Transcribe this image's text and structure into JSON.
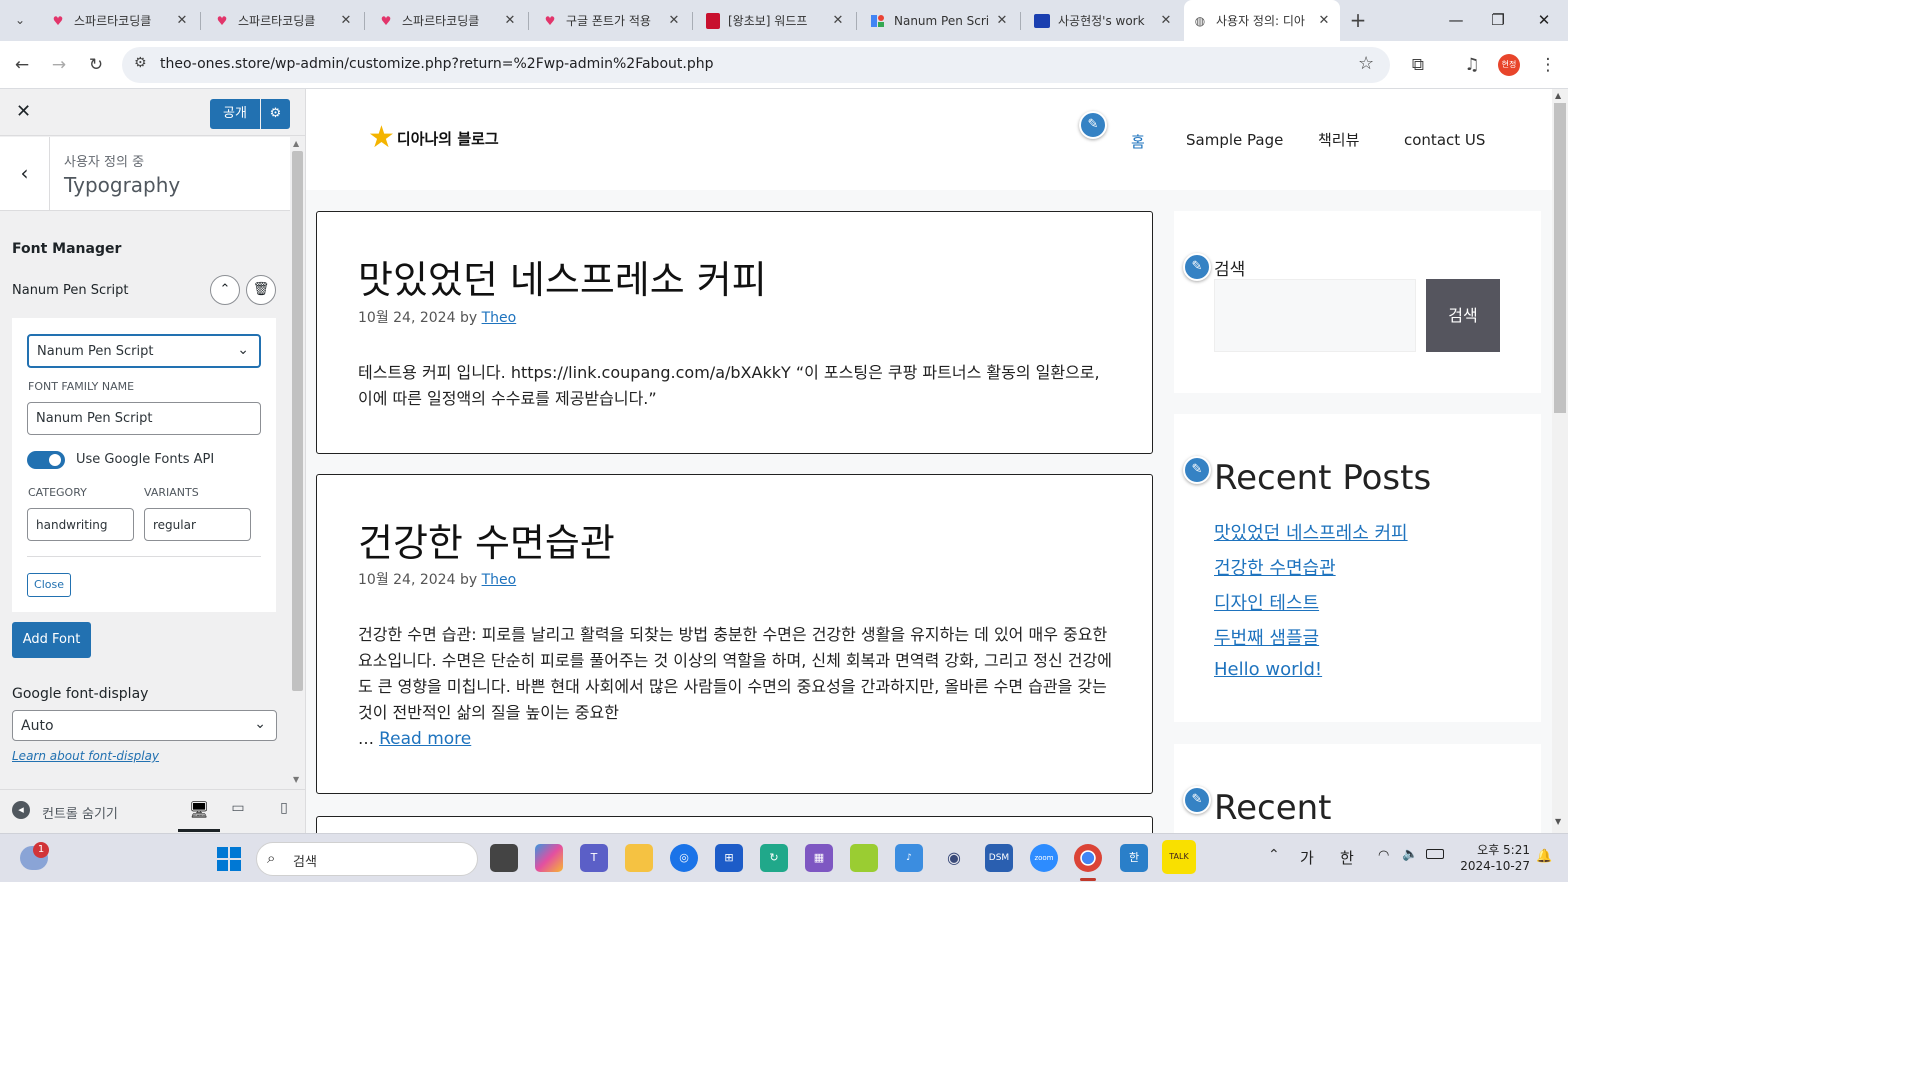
{
  "browser": {
    "tabs": [
      {
        "title": "스파르타코딩클",
        "favicon": "heart-icon"
      },
      {
        "title": "스파르타코딩클",
        "favicon": "heart-icon"
      },
      {
        "title": "스파르타코딩클",
        "favicon": "heart-icon"
      },
      {
        "title": "구글 폰트가 적용",
        "favicon": "heart-icon"
      },
      {
        "title": "[왕초보] 워드프",
        "favicon": "book-icon"
      },
      {
        "title": "Nanum Pen Scri",
        "favicon": "google-fonts-icon"
      },
      {
        "title": "사공현정's work",
        "favicon": "card-icon"
      },
      {
        "title": "사용자 정의: 디아",
        "favicon": "globe-icon"
      }
    ],
    "url": "theo-ones.store/wp-admin/customize.php?return=%2Fwp-admin%2Fabout.php",
    "profile_badge": "현정"
  },
  "customizer": {
    "publish_label": "공개",
    "breadcrumb_small": "사용자 정의 중",
    "section_title": "Typography",
    "font_manager_title": "Font Manager",
    "font_item_name": "Nanum Pen Script",
    "selected_font": "Nanum Pen Script",
    "family_name_label": "FONT FAMILY NAME",
    "family_name_value": "Nanum Pen Script",
    "google_api_label": "Use Google Fonts API",
    "category_label": "CATEGORY",
    "category_value": "handwriting",
    "variants_label": "VARIANTS",
    "variants_value": "regular",
    "close_label": "Close",
    "add_font_label": "Add Font",
    "font_display_label": "Google font-display",
    "font_display_value": "Auto",
    "font_display_link": "Learn about font-display",
    "hide_controls_label": "컨트롤 숨기기"
  },
  "site": {
    "logo_text": "디아나의 블로그",
    "nav": [
      "홈",
      "Sample Page",
      "책리뷰",
      "contact US"
    ],
    "posts": [
      {
        "title": "맛있었던 네스프레소 커피",
        "date": "10월 24, 2024",
        "by": "by",
        "author": "Theo",
        "body": "테스트용 커피 입니다.      https://link.coupang.com/a/bXAkkY “이 포스팅은 쿠팡 파트너스 활동의 일환으로, 이에 따른 일정액의 수수료를 제공받습니다.”"
      },
      {
        "title": "건강한 수면습관",
        "date": "10월 24, 2024",
        "by": "by",
        "author": "Theo",
        "body": "건강한 수면 습관: 피로를 날리고 활력을 되찾는 방법   충분한 수면은 건강한 생활을 유지하는 데 있어 매우 중요한 요소입니다. 수면은 단순히 피로를 풀어주는 것 이상의 역할을 하며, 신체 회복과 면역력 강화, 그리고 정신 건강에도 큰 영향을 미칩니다. 바쁜 현대 사회에서 많은 사람들이 수면의 중요성을 간과하지만, 올바른 수면 습관을 갖는 것이 전반적인 삶의 질을 높이는 중요한",
        "ellipsis": "…",
        "read_more": "Read more"
      }
    ],
    "search_widget_title": "검색",
    "search_button": "검색",
    "recent_posts_title": "Recent Posts",
    "recent_posts": [
      "맛있었던 네스프레소 커피",
      "건강한 수면습관",
      "디자인 테스트",
      "두번째 샘플글",
      "Hello world!"
    ],
    "recent_title_2": "Recent"
  },
  "taskbar": {
    "search_placeholder": "검색",
    "notification_count": "1",
    "ime_1": "가",
    "ime_2": "한",
    "time": "오후 5:21",
    "date": "2024-10-27"
  },
  "colors": {
    "accent": "#2271b1",
    "link": "#1e73be",
    "tabstrip": "#dfe3eb"
  }
}
